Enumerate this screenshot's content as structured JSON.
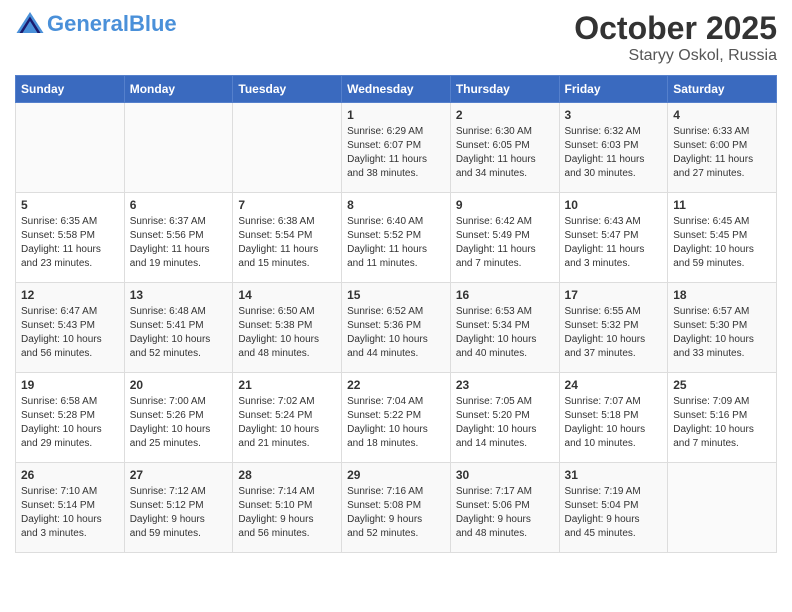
{
  "header": {
    "logo_line1": "General",
    "logo_line2": "Blue",
    "title": "October 2025",
    "subtitle": "Staryy Oskol, Russia"
  },
  "days_of_week": [
    "Sunday",
    "Monday",
    "Tuesday",
    "Wednesday",
    "Thursday",
    "Friday",
    "Saturday"
  ],
  "weeks": [
    [
      {
        "day": "",
        "info": ""
      },
      {
        "day": "",
        "info": ""
      },
      {
        "day": "",
        "info": ""
      },
      {
        "day": "1",
        "info": "Sunrise: 6:29 AM\nSunset: 6:07 PM\nDaylight: 11 hours\nand 38 minutes."
      },
      {
        "day": "2",
        "info": "Sunrise: 6:30 AM\nSunset: 6:05 PM\nDaylight: 11 hours\nand 34 minutes."
      },
      {
        "day": "3",
        "info": "Sunrise: 6:32 AM\nSunset: 6:03 PM\nDaylight: 11 hours\nand 30 minutes."
      },
      {
        "day": "4",
        "info": "Sunrise: 6:33 AM\nSunset: 6:00 PM\nDaylight: 11 hours\nand 27 minutes."
      }
    ],
    [
      {
        "day": "5",
        "info": "Sunrise: 6:35 AM\nSunset: 5:58 PM\nDaylight: 11 hours\nand 23 minutes."
      },
      {
        "day": "6",
        "info": "Sunrise: 6:37 AM\nSunset: 5:56 PM\nDaylight: 11 hours\nand 19 minutes."
      },
      {
        "day": "7",
        "info": "Sunrise: 6:38 AM\nSunset: 5:54 PM\nDaylight: 11 hours\nand 15 minutes."
      },
      {
        "day": "8",
        "info": "Sunrise: 6:40 AM\nSunset: 5:52 PM\nDaylight: 11 hours\nand 11 minutes."
      },
      {
        "day": "9",
        "info": "Sunrise: 6:42 AM\nSunset: 5:49 PM\nDaylight: 11 hours\nand 7 minutes."
      },
      {
        "day": "10",
        "info": "Sunrise: 6:43 AM\nSunset: 5:47 PM\nDaylight: 11 hours\nand 3 minutes."
      },
      {
        "day": "11",
        "info": "Sunrise: 6:45 AM\nSunset: 5:45 PM\nDaylight: 10 hours\nand 59 minutes."
      }
    ],
    [
      {
        "day": "12",
        "info": "Sunrise: 6:47 AM\nSunset: 5:43 PM\nDaylight: 10 hours\nand 56 minutes."
      },
      {
        "day": "13",
        "info": "Sunrise: 6:48 AM\nSunset: 5:41 PM\nDaylight: 10 hours\nand 52 minutes."
      },
      {
        "day": "14",
        "info": "Sunrise: 6:50 AM\nSunset: 5:38 PM\nDaylight: 10 hours\nand 48 minutes."
      },
      {
        "day": "15",
        "info": "Sunrise: 6:52 AM\nSunset: 5:36 PM\nDaylight: 10 hours\nand 44 minutes."
      },
      {
        "day": "16",
        "info": "Sunrise: 6:53 AM\nSunset: 5:34 PM\nDaylight: 10 hours\nand 40 minutes."
      },
      {
        "day": "17",
        "info": "Sunrise: 6:55 AM\nSunset: 5:32 PM\nDaylight: 10 hours\nand 37 minutes."
      },
      {
        "day": "18",
        "info": "Sunrise: 6:57 AM\nSunset: 5:30 PM\nDaylight: 10 hours\nand 33 minutes."
      }
    ],
    [
      {
        "day": "19",
        "info": "Sunrise: 6:58 AM\nSunset: 5:28 PM\nDaylight: 10 hours\nand 29 minutes."
      },
      {
        "day": "20",
        "info": "Sunrise: 7:00 AM\nSunset: 5:26 PM\nDaylight: 10 hours\nand 25 minutes."
      },
      {
        "day": "21",
        "info": "Sunrise: 7:02 AM\nSunset: 5:24 PM\nDaylight: 10 hours\nand 21 minutes."
      },
      {
        "day": "22",
        "info": "Sunrise: 7:04 AM\nSunset: 5:22 PM\nDaylight: 10 hours\nand 18 minutes."
      },
      {
        "day": "23",
        "info": "Sunrise: 7:05 AM\nSunset: 5:20 PM\nDaylight: 10 hours\nand 14 minutes."
      },
      {
        "day": "24",
        "info": "Sunrise: 7:07 AM\nSunset: 5:18 PM\nDaylight: 10 hours\nand 10 minutes."
      },
      {
        "day": "25",
        "info": "Sunrise: 7:09 AM\nSunset: 5:16 PM\nDaylight: 10 hours\nand 7 minutes."
      }
    ],
    [
      {
        "day": "26",
        "info": "Sunrise: 7:10 AM\nSunset: 5:14 PM\nDaylight: 10 hours\nand 3 minutes."
      },
      {
        "day": "27",
        "info": "Sunrise: 7:12 AM\nSunset: 5:12 PM\nDaylight: 9 hours\nand 59 minutes."
      },
      {
        "day": "28",
        "info": "Sunrise: 7:14 AM\nSunset: 5:10 PM\nDaylight: 9 hours\nand 56 minutes."
      },
      {
        "day": "29",
        "info": "Sunrise: 7:16 AM\nSunset: 5:08 PM\nDaylight: 9 hours\nand 52 minutes."
      },
      {
        "day": "30",
        "info": "Sunrise: 7:17 AM\nSunset: 5:06 PM\nDaylight: 9 hours\nand 48 minutes."
      },
      {
        "day": "31",
        "info": "Sunrise: 7:19 AM\nSunset: 5:04 PM\nDaylight: 9 hours\nand 45 minutes."
      },
      {
        "day": "",
        "info": ""
      }
    ]
  ]
}
